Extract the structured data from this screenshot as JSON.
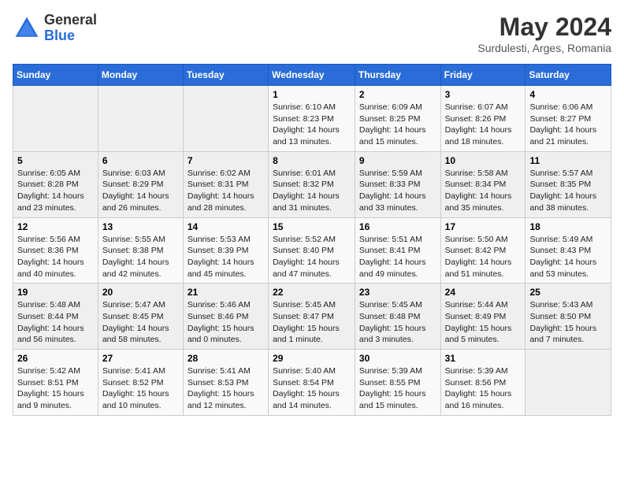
{
  "logo": {
    "general": "General",
    "blue": "Blue"
  },
  "title": "May 2024",
  "location": "Surdulesti, Arges, Romania",
  "days_header": [
    "Sunday",
    "Monday",
    "Tuesday",
    "Wednesday",
    "Thursday",
    "Friday",
    "Saturday"
  ],
  "weeks": [
    [
      {
        "day": "",
        "info": ""
      },
      {
        "day": "",
        "info": ""
      },
      {
        "day": "",
        "info": ""
      },
      {
        "day": "1",
        "info": "Sunrise: 6:10 AM\nSunset: 8:23 PM\nDaylight: 14 hours and 13 minutes."
      },
      {
        "day": "2",
        "info": "Sunrise: 6:09 AM\nSunset: 8:25 PM\nDaylight: 14 hours and 15 minutes."
      },
      {
        "day": "3",
        "info": "Sunrise: 6:07 AM\nSunset: 8:26 PM\nDaylight: 14 hours and 18 minutes."
      },
      {
        "day": "4",
        "info": "Sunrise: 6:06 AM\nSunset: 8:27 PM\nDaylight: 14 hours and 21 minutes."
      }
    ],
    [
      {
        "day": "5",
        "info": "Sunrise: 6:05 AM\nSunset: 8:28 PM\nDaylight: 14 hours and 23 minutes."
      },
      {
        "day": "6",
        "info": "Sunrise: 6:03 AM\nSunset: 8:29 PM\nDaylight: 14 hours and 26 minutes."
      },
      {
        "day": "7",
        "info": "Sunrise: 6:02 AM\nSunset: 8:31 PM\nDaylight: 14 hours and 28 minutes."
      },
      {
        "day": "8",
        "info": "Sunrise: 6:01 AM\nSunset: 8:32 PM\nDaylight: 14 hours and 31 minutes."
      },
      {
        "day": "9",
        "info": "Sunrise: 5:59 AM\nSunset: 8:33 PM\nDaylight: 14 hours and 33 minutes."
      },
      {
        "day": "10",
        "info": "Sunrise: 5:58 AM\nSunset: 8:34 PM\nDaylight: 14 hours and 35 minutes."
      },
      {
        "day": "11",
        "info": "Sunrise: 5:57 AM\nSunset: 8:35 PM\nDaylight: 14 hours and 38 minutes."
      }
    ],
    [
      {
        "day": "12",
        "info": "Sunrise: 5:56 AM\nSunset: 8:36 PM\nDaylight: 14 hours and 40 minutes."
      },
      {
        "day": "13",
        "info": "Sunrise: 5:55 AM\nSunset: 8:38 PM\nDaylight: 14 hours and 42 minutes."
      },
      {
        "day": "14",
        "info": "Sunrise: 5:53 AM\nSunset: 8:39 PM\nDaylight: 14 hours and 45 minutes."
      },
      {
        "day": "15",
        "info": "Sunrise: 5:52 AM\nSunset: 8:40 PM\nDaylight: 14 hours and 47 minutes."
      },
      {
        "day": "16",
        "info": "Sunrise: 5:51 AM\nSunset: 8:41 PM\nDaylight: 14 hours and 49 minutes."
      },
      {
        "day": "17",
        "info": "Sunrise: 5:50 AM\nSunset: 8:42 PM\nDaylight: 14 hours and 51 minutes."
      },
      {
        "day": "18",
        "info": "Sunrise: 5:49 AM\nSunset: 8:43 PM\nDaylight: 14 hours and 53 minutes."
      }
    ],
    [
      {
        "day": "19",
        "info": "Sunrise: 5:48 AM\nSunset: 8:44 PM\nDaylight: 14 hours and 56 minutes."
      },
      {
        "day": "20",
        "info": "Sunrise: 5:47 AM\nSunset: 8:45 PM\nDaylight: 14 hours and 58 minutes."
      },
      {
        "day": "21",
        "info": "Sunrise: 5:46 AM\nSunset: 8:46 PM\nDaylight: 15 hours and 0 minutes."
      },
      {
        "day": "22",
        "info": "Sunrise: 5:45 AM\nSunset: 8:47 PM\nDaylight: 15 hours and 1 minute."
      },
      {
        "day": "23",
        "info": "Sunrise: 5:45 AM\nSunset: 8:48 PM\nDaylight: 15 hours and 3 minutes."
      },
      {
        "day": "24",
        "info": "Sunrise: 5:44 AM\nSunset: 8:49 PM\nDaylight: 15 hours and 5 minutes."
      },
      {
        "day": "25",
        "info": "Sunrise: 5:43 AM\nSunset: 8:50 PM\nDaylight: 15 hours and 7 minutes."
      }
    ],
    [
      {
        "day": "26",
        "info": "Sunrise: 5:42 AM\nSunset: 8:51 PM\nDaylight: 15 hours and 9 minutes."
      },
      {
        "day": "27",
        "info": "Sunrise: 5:41 AM\nSunset: 8:52 PM\nDaylight: 15 hours and 10 minutes."
      },
      {
        "day": "28",
        "info": "Sunrise: 5:41 AM\nSunset: 8:53 PM\nDaylight: 15 hours and 12 minutes."
      },
      {
        "day": "29",
        "info": "Sunrise: 5:40 AM\nSunset: 8:54 PM\nDaylight: 15 hours and 14 minutes."
      },
      {
        "day": "30",
        "info": "Sunrise: 5:39 AM\nSunset: 8:55 PM\nDaylight: 15 hours and 15 minutes."
      },
      {
        "day": "31",
        "info": "Sunrise: 5:39 AM\nSunset: 8:56 PM\nDaylight: 15 hours and 16 minutes."
      },
      {
        "day": "",
        "info": ""
      }
    ]
  ]
}
